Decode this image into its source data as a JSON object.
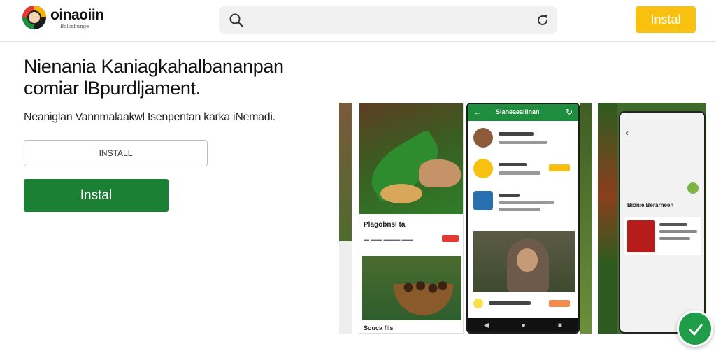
{
  "header": {
    "brand": "oinaoiin",
    "brand_sub": "Bolorbunge",
    "search_placeholder": "",
    "install_label": "Instal"
  },
  "hero": {
    "headline": "Nienania Kaniagkahalbananpan comiar lBpurdljament.",
    "subline": "Neaniglan Vannmalaakwl Isenpentan karka iNemadi.",
    "field_value": "INSTALL",
    "install_label": "Instal"
  },
  "gallery": {
    "card_b_title": "Plagobnsl ta",
    "card_b_caption": "Souca flis",
    "card_c_title": "Sianeaeailinan",
    "card_e_title": "Bionie Berarneen"
  },
  "icons": {
    "logo": "app-logo-icon",
    "search": "search-icon",
    "reload": "reload-icon",
    "check": "checkmark-icon"
  },
  "colors": {
    "accent_yellow": "#f8c10f",
    "primary_green": "#1b7f34",
    "badge_green": "#1f9d48"
  }
}
